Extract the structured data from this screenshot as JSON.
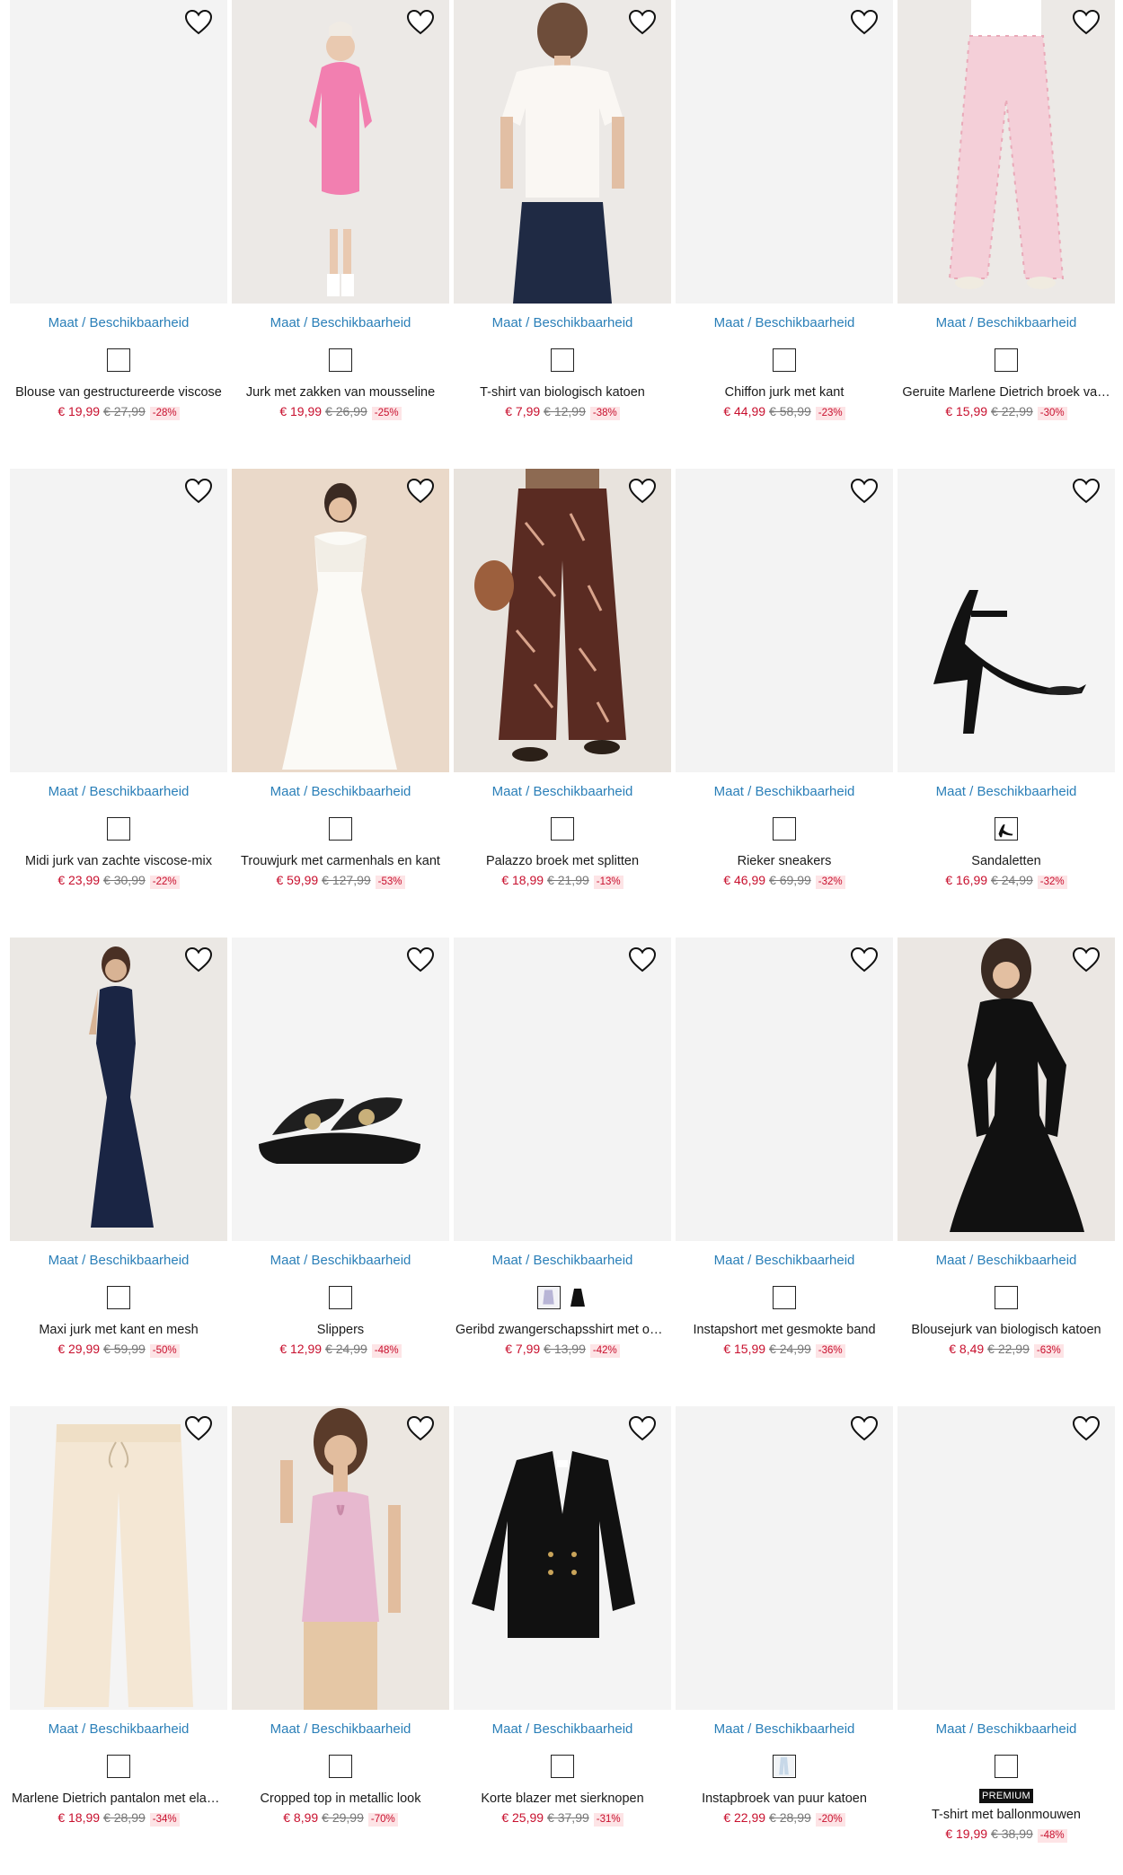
{
  "availability_label_prefix": "Maat",
  "availability_label_sep": "/",
  "availability_label_suffix": "Beschikbaarheid",
  "products": [
    {
      "title": "Blouse van gestructureerde viscose",
      "price": "€ 19,99",
      "old_price": "€ 27,99",
      "discount": "-28%",
      "image": "blank",
      "swatches": [
        "empty"
      ]
    },
    {
      "title": "Jurk met zakken van mousseline",
      "price": "€ 19,99",
      "old_price": "€ 26,99",
      "discount": "-25%",
      "image": "pink-dress",
      "swatches": [
        "empty"
      ]
    },
    {
      "title": "T-shirt van biologisch katoen",
      "price": "€ 7,99",
      "old_price": "€ 12,99",
      "discount": "-38%",
      "image": "white-tee",
      "swatches": [
        "empty"
      ]
    },
    {
      "title": "Chiffon jurk met kant",
      "price": "€ 44,99",
      "old_price": "€ 58,99",
      "discount": "-23%",
      "image": "blank",
      "swatches": [
        "empty"
      ]
    },
    {
      "title": "Geruite Marlene Dietrich broek va…",
      "price": "€ 15,99",
      "old_price": "€ 22,99",
      "discount": "-30%",
      "image": "pink-pants",
      "swatches": [
        "empty"
      ]
    },
    {
      "title": "Midi jurk van zachte viscose-mix",
      "price": "€ 23,99",
      "old_price": "€ 30,99",
      "discount": "-22%",
      "image": "blank",
      "swatches": [
        "empty"
      ]
    },
    {
      "title": "Trouwjurk met carmenhals en kant",
      "price": "€ 59,99",
      "old_price": "€ 127,99",
      "discount": "-53%",
      "image": "wedding-dress",
      "swatches": [
        "empty"
      ]
    },
    {
      "title": "Palazzo broek met splitten",
      "price": "€ 18,99",
      "old_price": "€ 21,99",
      "discount": "-13%",
      "image": "palazzo",
      "swatches": [
        "empty"
      ]
    },
    {
      "title": "Rieker sneakers",
      "price": "€ 46,99",
      "old_price": "€ 69,99",
      "discount": "-32%",
      "image": "blank",
      "swatches": [
        "empty"
      ]
    },
    {
      "title": "Sandaletten",
      "price": "€ 16,99",
      "old_price": "€ 24,99",
      "discount": "-32%",
      "image": "sandal",
      "swatches": [
        "sandal"
      ]
    },
    {
      "title": "Maxi jurk met kant en mesh",
      "price": "€ 29,99",
      "old_price": "€ 59,99",
      "discount": "-50%",
      "image": "navy-gown",
      "swatches": [
        "empty"
      ]
    },
    {
      "title": "Slippers",
      "price": "€ 12,99",
      "old_price": "€ 24,99",
      "discount": "-48%",
      "image": "slippers",
      "swatches": [
        "empty"
      ]
    },
    {
      "title": "Geribd zwangerschapsshirt met op…",
      "price": "€ 7,99",
      "old_price": "€ 13,99",
      "discount": "-42%",
      "image": "blank",
      "swatches": [
        "lilac",
        "black"
      ]
    },
    {
      "title": "Instapshort met gesmokte band",
      "price": "€ 15,99",
      "old_price": "€ 24,99",
      "discount": "-36%",
      "image": "blank",
      "swatches": [
        "empty"
      ]
    },
    {
      "title": "Blousejurk van biologisch katoen",
      "price": "€ 8,49",
      "old_price": "€ 22,99",
      "discount": "-63%",
      "image": "black-dress",
      "swatches": [
        "empty"
      ]
    },
    {
      "title": "Marlene Dietrich pantalon met elas…",
      "price": "€ 18,99",
      "old_price": "€ 28,99",
      "discount": "-34%",
      "image": "cream-pants",
      "swatches": [
        "empty"
      ]
    },
    {
      "title": "Cropped top in metallic look",
      "price": "€ 8,99",
      "old_price": "€ 29,99",
      "discount": "-70%",
      "image": "pink-top",
      "swatches": [
        "empty"
      ]
    },
    {
      "title": "Korte blazer met sierknopen",
      "price": "€ 25,99",
      "old_price": "€ 37,99",
      "discount": "-31%",
      "image": "blazer",
      "swatches": [
        "empty"
      ]
    },
    {
      "title": "Instapbroek van puur katoen",
      "price": "€ 22,99",
      "old_price": "€ 28,99",
      "discount": "-20%",
      "image": "blank",
      "swatches": [
        "lightblue"
      ]
    },
    {
      "title": "T-shirt met ballonmouwen",
      "price": "€ 19,99",
      "old_price": "€ 38,99",
      "discount": "-48%",
      "image": "blank",
      "swatches": [
        "empty"
      ],
      "badge": "PREMIUM"
    }
  ]
}
